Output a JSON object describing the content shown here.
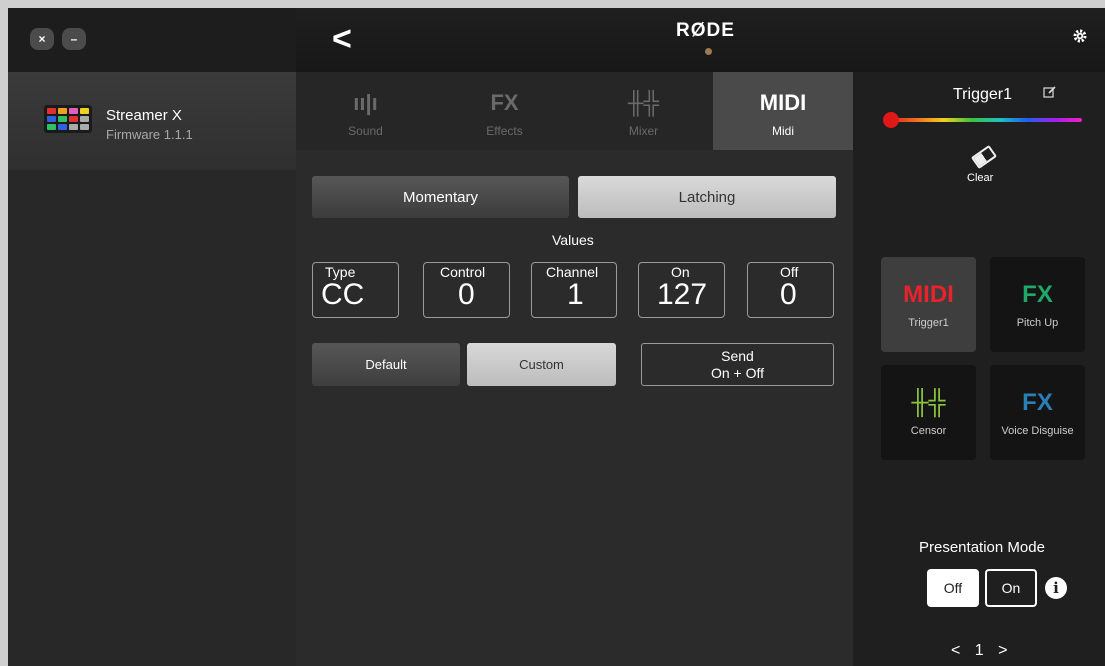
{
  "window": {
    "close_glyph": "×",
    "minimize_glyph": "–"
  },
  "device": {
    "name": "Streamer X",
    "firmware": "Firmware 1.1.1"
  },
  "header": {
    "logo": "RØDE",
    "back_glyph": "<",
    "settings_icon": "gear-icon"
  },
  "tabs": [
    {
      "icon": "ıı|ı",
      "label": "Sound",
      "active": false
    },
    {
      "icon": "FX",
      "label": "Effects",
      "active": false
    },
    {
      "icon": "╫╬",
      "label": "Mixer",
      "active": false
    },
    {
      "icon": "MIDI",
      "label": "Midi",
      "active": true
    }
  ],
  "midi": {
    "mode": {
      "momentary": "Momentary",
      "latching": "Latching",
      "selected": "Latching"
    },
    "values_title": "Values",
    "fields": [
      {
        "label": "Type",
        "value": "CC"
      },
      {
        "label": "Control",
        "value": "0"
      },
      {
        "label": "Channel",
        "value": "1"
      },
      {
        "label": "On",
        "value": "127"
      },
      {
        "label": "Off",
        "value": "0"
      }
    ],
    "preset": {
      "default": "Default",
      "custom": "Custom",
      "selected": "Custom"
    },
    "send": {
      "line1": "Send",
      "line2": "On + Off"
    }
  },
  "right": {
    "trigger_name": "Trigger1",
    "clear_label": "Clear",
    "pads": [
      {
        "icon": "MIDI",
        "label": "Trigger1",
        "color": "#e8232b",
        "selected": true
      },
      {
        "icon": "FX",
        "label": "Pitch Up",
        "color": "#1fa86a",
        "selected": false
      },
      {
        "icon": "╫╬",
        "label": "Censor",
        "color": "#8cc63f",
        "selected": false
      },
      {
        "icon": "FX",
        "label": "Voice Disguise",
        "color": "#2a7fb8",
        "selected": false
      }
    ],
    "presentation": {
      "title": "Presentation Mode",
      "off": "Off",
      "on": "On",
      "selected": "Off"
    },
    "pager": {
      "prev": "<",
      "page": "1",
      "next": ">"
    }
  }
}
